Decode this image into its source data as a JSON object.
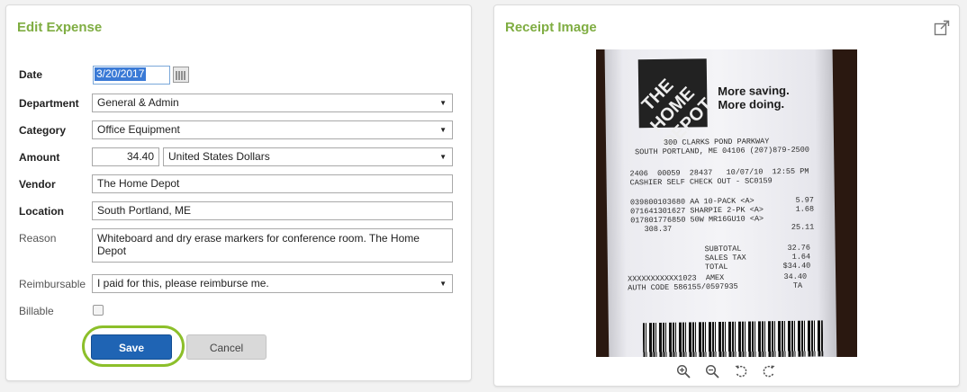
{
  "edit_expense": {
    "title": "Edit Expense",
    "date": {
      "label": "Date",
      "value": "3/20/2017"
    },
    "department": {
      "label": "Department",
      "value": "General & Admin"
    },
    "category": {
      "label": "Category",
      "value": "Office Equipment"
    },
    "amount": {
      "label": "Amount",
      "value": "34.40",
      "currency": "United States Dollars"
    },
    "vendor": {
      "label": "Vendor",
      "value": "The Home Depot"
    },
    "location": {
      "label": "Location",
      "value": "South Portland, ME"
    },
    "reason": {
      "label": "Reason",
      "value": "Whiteboard and dry erase markers for conference room. The Home Depot"
    },
    "reimbursable": {
      "label": "Reimbursable",
      "value": "I paid for this, please reimburse me."
    },
    "billable": {
      "label": "Billable",
      "checked": false
    },
    "buttons": {
      "save": "Save",
      "cancel": "Cancel"
    }
  },
  "receipt_image": {
    "title": "Receipt Image",
    "icons": [
      "external-link-icon",
      "zoom-in-icon",
      "zoom-out-icon",
      "rotate-left-icon",
      "rotate-right-icon"
    ],
    "receipt": {
      "logo": "THE HOME DEPOT",
      "slogan_1": "More saving.",
      "slogan_2": "More doing.",
      "address_1": "300 CLARKS POND PARKWAY",
      "address_2": "SOUTH PORTLAND, ME 04106 (207)879-2500",
      "line_1": "2406  00059  28437   10/07/10  12:55 PM",
      "line_2": "CASHIER SELF CHECK OUT - SC0159",
      "item_1": "039800103680 AA 10-PACK <A>         5.97",
      "item_2": "071641301627 SHARPIE 2-PK <A>       1.68",
      "item_3": "017801776850 50W MR16GU10 <A>",
      "item_3b": "   308.37                          25.11",
      "subtotal": "SUBTOTAL          32.76",
      "sales_tax": "SALES TAX          1.64",
      "total": "TOTAL            $34.40",
      "card": "XXXXXXXXXXX1023  AMEX             34.40",
      "auth": "AUTH CODE 586155/0597935            TA"
    }
  },
  "colors": {
    "title_green": "#7fad42",
    "save_blue": "#1f64b4",
    "highlight_ring": "#8cbf2a"
  }
}
